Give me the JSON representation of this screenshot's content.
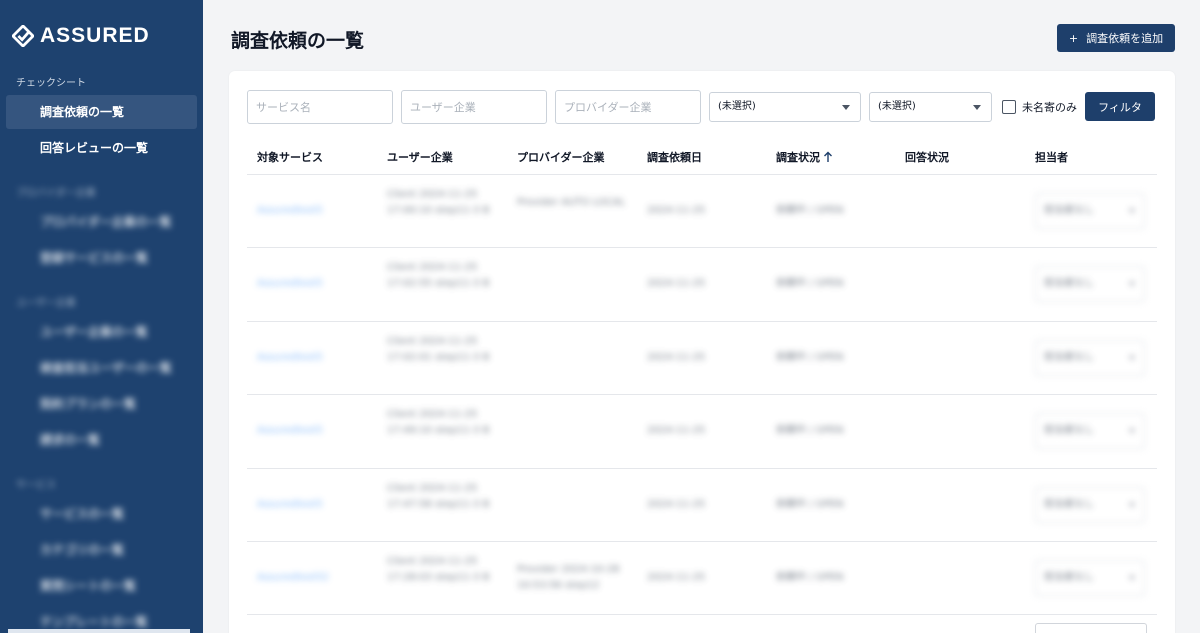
{
  "brand": {
    "name": "ASSURED"
  },
  "sidebar": {
    "section_checksheet": "チェックシート",
    "items_checksheet": [
      {
        "label": "調査依頼の一覧",
        "active": true
      },
      {
        "label": "回答レビューの一覧",
        "active": false
      }
    ],
    "section_provider": "プロバイダー企業",
    "items_provider": [
      {
        "label": "プロバイダー企業の一覧"
      },
      {
        "label": "登録サービスの一覧"
      }
    ],
    "section_user": "ユーザー企業",
    "items_user": [
      {
        "label": "ユーザー企業の一覧"
      },
      {
        "label": "検査担当ユーザーの一覧"
      },
      {
        "label": "契約プランの一覧"
      },
      {
        "label": "請求の一覧"
      }
    ],
    "section_service": "サービス",
    "items_service": [
      {
        "label": "サービスの一覧"
      },
      {
        "label": "カテゴリの一覧"
      },
      {
        "label": "質問シートの一覧"
      },
      {
        "label": "テンプレートの一覧"
      }
    ]
  },
  "header": {
    "title": "調査依頼の一覧",
    "add_button_icon": "+",
    "add_button_label": "調査依頼を追加"
  },
  "filters": {
    "service_placeholder": "サービス名",
    "user_company_placeholder": "ユーザー企業",
    "provider_company_placeholder": "プロバイダー企業",
    "select1_value": "(未選択)",
    "select2_value": "(未選択)",
    "anonymous_only_label": "未名寄のみ",
    "filter_button_label": "フィルタ"
  },
  "table": {
    "headers": {
      "service": "対象サービス",
      "user_company": "ユーザー企業",
      "provider_company": "プロバイダー企業",
      "request_date": "調査依頼日",
      "status": "調査状況",
      "answer_status": "回答状況",
      "assignee": "担当者"
    },
    "sort_icon": "arrow-up-icon",
    "rows": [
      {
        "service": "Assuredtest5",
        "user_company": "Client 2024-11-25 17:00:10 step11-3 B",
        "provider_company": "Provider AUTO LOCAL",
        "request_date": "2024-11-25",
        "status": "依頼中 / OPEN",
        "answer_status": "",
        "assignee": "担当者なし"
      },
      {
        "service": "Assuredtest5",
        "user_company": "Client 2024-11-25 17:02:55 step11-3 B",
        "provider_company": "",
        "request_date": "2024-11-25",
        "status": "依頼中 / OPEN",
        "answer_status": "",
        "assignee": "担当者なし"
      },
      {
        "service": "Assuredtest5",
        "user_company": "Client 2024-11-25 17:02:01 step11-3 B",
        "provider_company": "",
        "request_date": "2024-11-25",
        "status": "依頼中 / OPEN",
        "answer_status": "",
        "assignee": "担当者なし"
      },
      {
        "service": "Assuredtest5",
        "user_company": "Client 2024-11-25 17:49:10 step11-3 B",
        "provider_company": "",
        "request_date": "2024-11-25",
        "status": "依頼中 / OPEN",
        "answer_status": "",
        "assignee": "担当者なし"
      },
      {
        "service": "Assuredtest5",
        "user_company": "Client 2024-11-25 17:47:58 step11-3 B",
        "provider_company": "",
        "request_date": "2024-11-25",
        "status": "依頼中 / OPEN",
        "answer_status": "",
        "assignee": "担当者なし"
      },
      {
        "service": "Assuredtest52",
        "user_company": "Client 2024-11-25 17:28:03 step11-3 B",
        "provider_company": "Provider 2024-10-28 10:53:56 step12",
        "request_date": "2024-11-25",
        "status": "依頼中 / OPEN",
        "answer_status": "",
        "assignee": "担当者なし"
      }
    ]
  },
  "colors": {
    "sidebar_bg": "#1e426f",
    "sidebar_active": "#35557f",
    "primary_button": "#1e3f6b",
    "link": "#60a5fa"
  }
}
